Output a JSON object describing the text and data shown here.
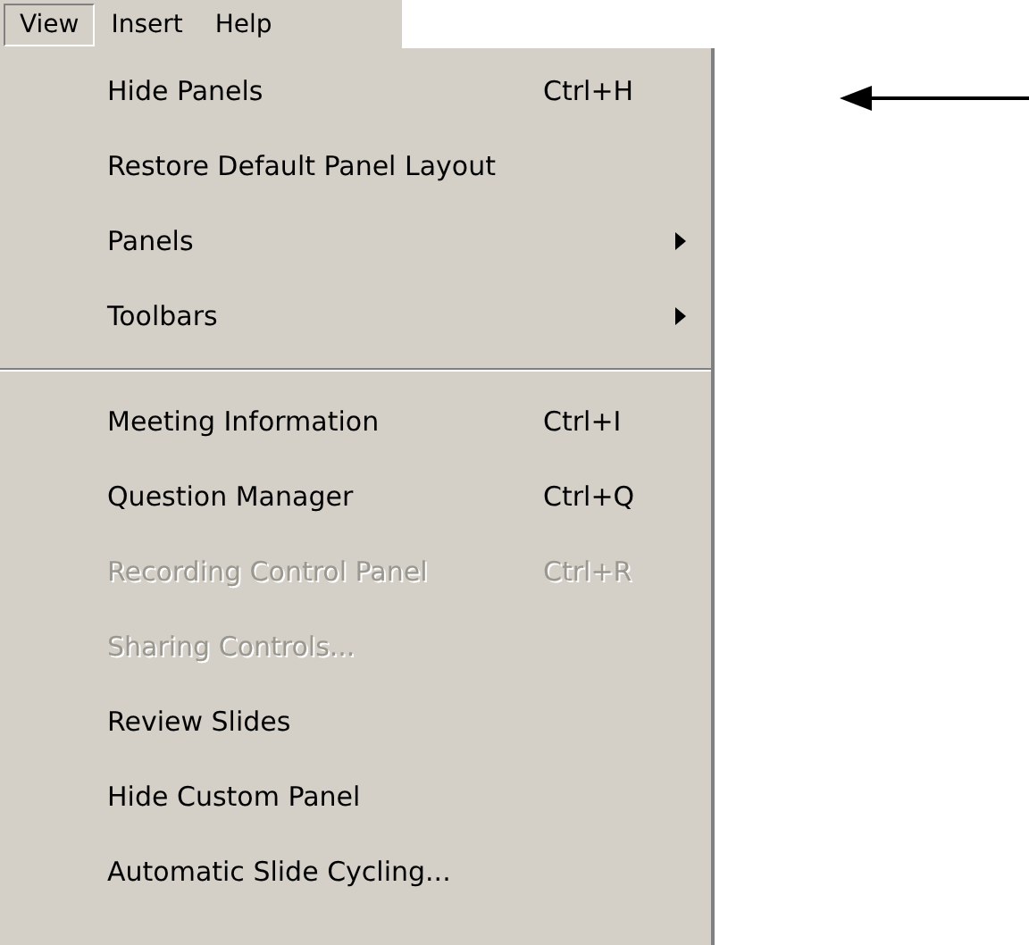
{
  "menu_bar": [
    {
      "label": "View",
      "selected": true
    },
    {
      "label": "Insert",
      "selected": false
    },
    {
      "label": "Help",
      "selected": false
    }
  ],
  "menu": {
    "items": [
      {
        "kind": "item",
        "label": "Hide Panels",
        "shortcut": "Ctrl+H",
        "disabled": false
      },
      {
        "kind": "item",
        "label": "Restore Default Panel Layout",
        "disabled": false
      },
      {
        "kind": "submenu",
        "label": "Panels",
        "disabled": false
      },
      {
        "kind": "submenu",
        "label": "Toolbars",
        "disabled": false
      },
      {
        "kind": "separator"
      },
      {
        "kind": "item",
        "label": "Meeting Information",
        "shortcut": "Ctrl+I",
        "disabled": false
      },
      {
        "kind": "item",
        "label": "Question Manager",
        "shortcut": "Ctrl+Q",
        "disabled": false
      },
      {
        "kind": "item",
        "label": "Recording Control Panel",
        "shortcut": "Ctrl+R",
        "disabled": true
      },
      {
        "kind": "item",
        "label": "Sharing Controls...",
        "disabled": true
      },
      {
        "kind": "item",
        "label": "Review Slides",
        "disabled": false
      },
      {
        "kind": "item",
        "label": "Hide Custom Panel",
        "disabled": false
      },
      {
        "kind": "item",
        "label": "Automatic Slide Cycling...",
        "disabled": false
      }
    ]
  }
}
